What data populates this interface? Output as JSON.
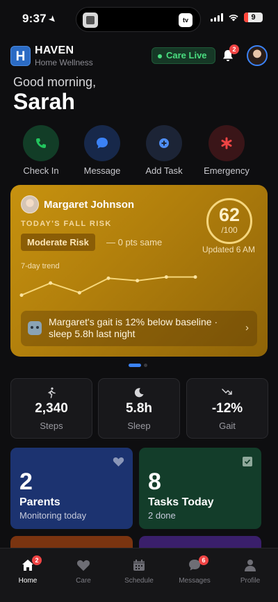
{
  "status_bar": {
    "time": "9:37",
    "battery": "9",
    "tv_label": "tv"
  },
  "header": {
    "logo_letter": "H",
    "brand": "HAVEN",
    "brand_sub": "Home Wellness",
    "live_label": "Care Live",
    "notifications_count": "2"
  },
  "greeting": {
    "line1": "Good morning,",
    "name": "Sarah"
  },
  "quick_actions": [
    {
      "label": "Check In",
      "icon": "phone-icon",
      "bg": "#123d27",
      "fg": "#22c55e"
    },
    {
      "label": "Message",
      "icon": "message-icon",
      "bg": "#17284a",
      "fg": "#3b82f6"
    },
    {
      "label": "Add Task",
      "icon": "add-task-icon",
      "bg": "#1c2436",
      "fg": "#4f8ef7"
    },
    {
      "label": "Emergency",
      "icon": "emergency-icon",
      "bg": "#3a1518",
      "fg": "#ef4444"
    }
  ],
  "hero": {
    "person_name": "Margaret Johnson",
    "risk_label": "TODAY'S FALL RISK",
    "risk_level": "Moderate Risk",
    "delta": "— 0 pts same",
    "score": "62",
    "score_max": "/100",
    "updated": "Updated 6 AM",
    "trend_label": "7-day trend",
    "trend_values": [
      48,
      58,
      50,
      62,
      60,
      63,
      63
    ],
    "insight": "Margaret's gait is 12% below baseline · sleep 5.8h last night"
  },
  "carousel": {
    "pages": 2,
    "active": 0
  },
  "stats": [
    {
      "value": "2,340",
      "label": "Steps",
      "icon": "walking-icon"
    },
    {
      "value": "5.8h",
      "label": "Sleep",
      "icon": "moon-icon"
    },
    {
      "value": "-12%",
      "label": "Gait",
      "icon": "trend-down-icon"
    }
  ],
  "tiles": [
    {
      "number": "2",
      "title": "Parents",
      "subtitle": "Monitoring today",
      "icon": "heart-icon",
      "bg": "#1c3370"
    },
    {
      "number": "8",
      "title": "Tasks Today",
      "subtitle": "2 done",
      "icon": "checkbox-icon",
      "bg": "#133d2a"
    }
  ],
  "peek_tiles": [
    {
      "bg": "#7a3410"
    },
    {
      "bg": "#3a1f6b"
    }
  ],
  "tabbar": [
    {
      "label": "Home",
      "icon": "home-icon",
      "badge": "2",
      "active": true
    },
    {
      "label": "Care",
      "icon": "heart-icon",
      "badge": "",
      "active": false
    },
    {
      "label": "Schedule",
      "icon": "calendar-icon",
      "badge": "",
      "active": false
    },
    {
      "label": "Messages",
      "icon": "chat-icon",
      "badge": "6",
      "active": false
    },
    {
      "label": "Profile",
      "icon": "person-icon",
      "badge": "",
      "active": false
    }
  ]
}
